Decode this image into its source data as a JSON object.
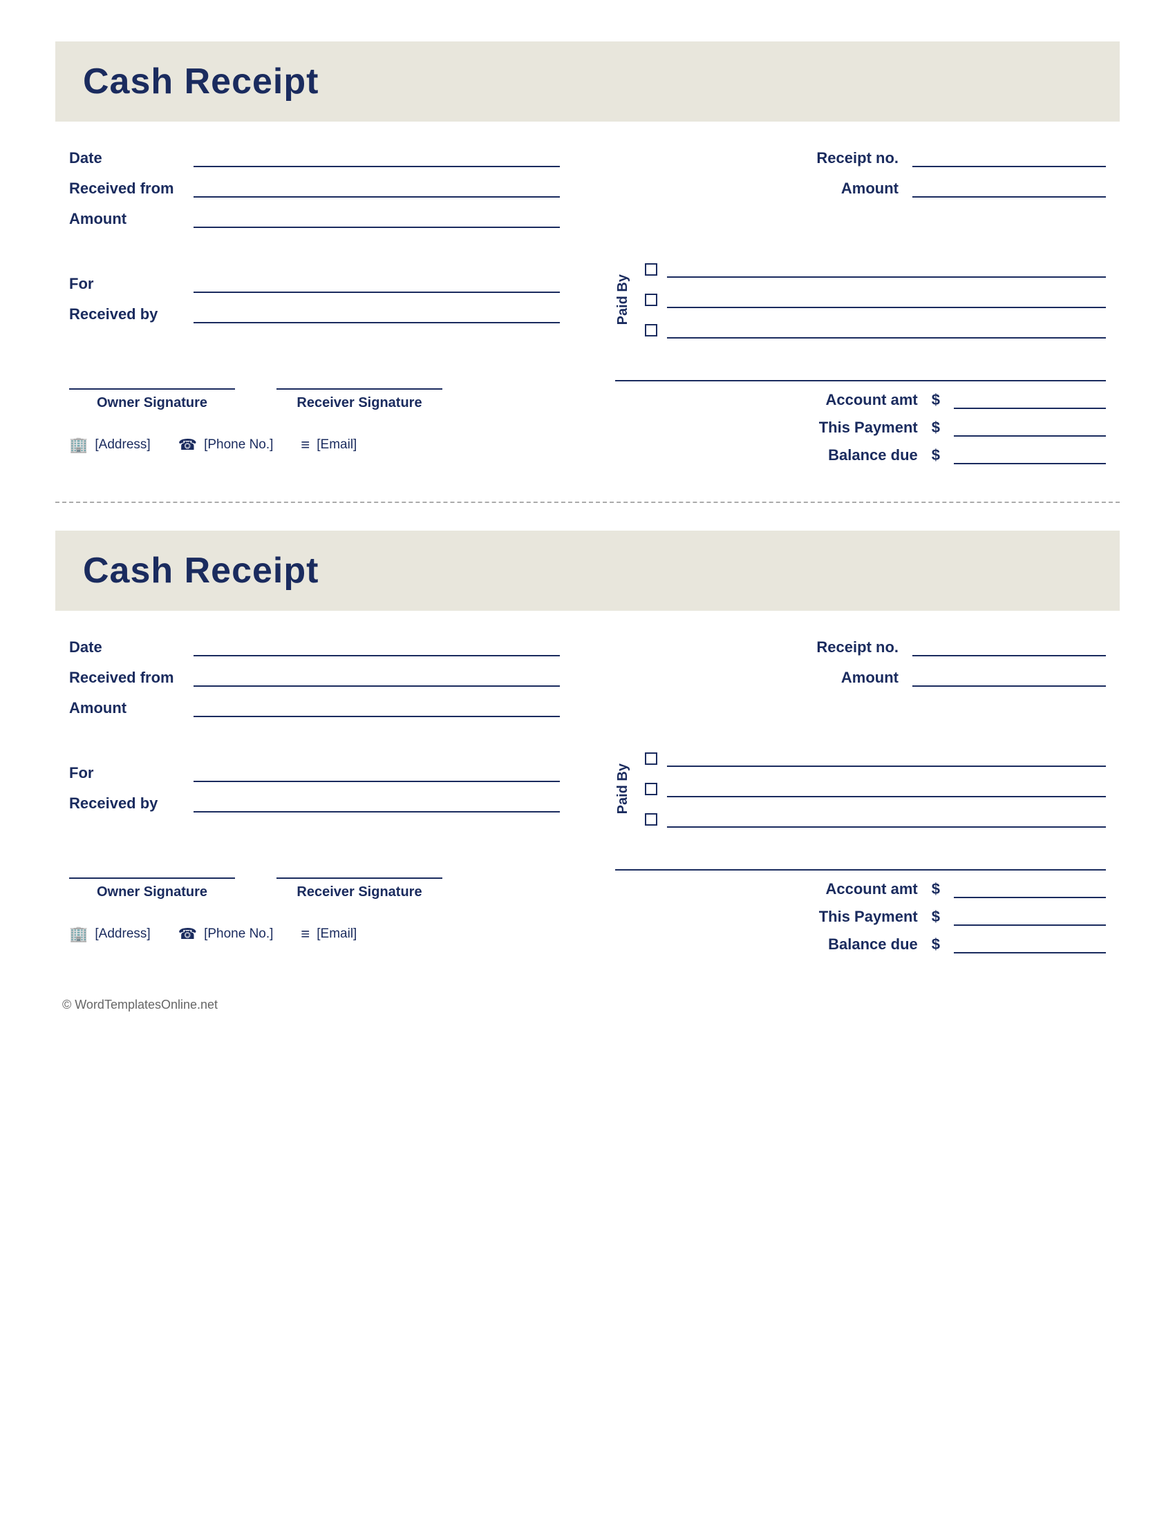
{
  "receipts": [
    {
      "title": "Cash Receipt",
      "fields": {
        "date_label": "Date",
        "received_from_label": "Received from",
        "amount_label": "Amount",
        "for_label": "For",
        "received_by_label": "Received by",
        "receipt_no_label": "Receipt no.",
        "right_amount_label": "Amount"
      },
      "paid_by": {
        "label": "Paid By",
        "options": [
          "",
          "",
          ""
        ]
      },
      "signatures": {
        "owner_label": "Owner Signature",
        "receiver_label": "Receiver Signature"
      },
      "footer": {
        "address_icon": "🏢",
        "address_text": "[Address]",
        "phone_icon": "📞",
        "phone_text": "[Phone No.]",
        "email_icon": "✉",
        "email_text": "[Email]"
      },
      "amounts": {
        "account_amt_label": "Account amt",
        "this_payment_label": "This Payment",
        "balance_due_label": "Balance due",
        "dollar_sign": "$"
      }
    },
    {
      "title": "Cash Receipt",
      "fields": {
        "date_label": "Date",
        "received_from_label": "Received from",
        "amount_label": "Amount",
        "for_label": "For",
        "received_by_label": "Received by",
        "receipt_no_label": "Receipt no.",
        "right_amount_label": "Amount"
      },
      "paid_by": {
        "label": "Paid By",
        "options": [
          "",
          "",
          ""
        ]
      },
      "signatures": {
        "owner_label": "Owner Signature",
        "receiver_label": "Receiver Signature"
      },
      "footer": {
        "address_icon": "🏢",
        "address_text": "[Address]",
        "phone_icon": "📞",
        "phone_text": "[Phone No.]",
        "email_icon": "✉",
        "email_text": "[Email]"
      },
      "amounts": {
        "account_amt_label": "Account amt",
        "this_payment_label": "This Payment",
        "balance_due_label": "Balance due",
        "dollar_sign": "$"
      }
    }
  ],
  "copyright": "© WordTemplatesOnline.net"
}
